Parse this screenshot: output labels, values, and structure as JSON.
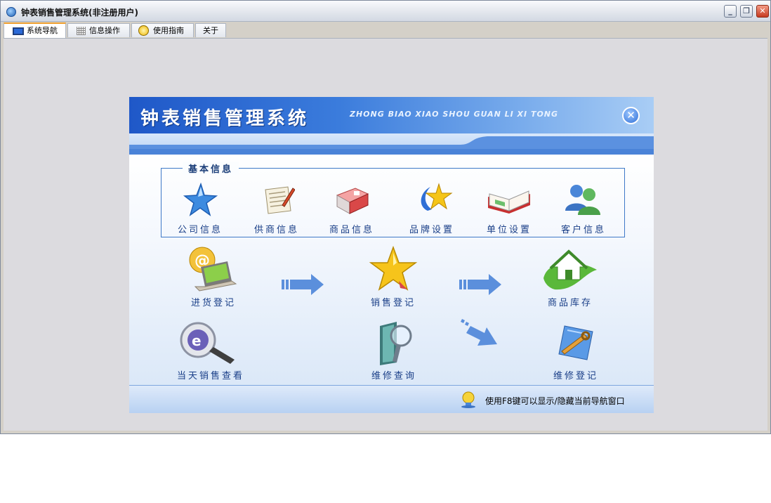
{
  "window": {
    "title": "钟表销售管理系统(非注册用户)",
    "buttons": {
      "minimize": "_",
      "restore": "❐",
      "close": "✕"
    }
  },
  "tabs": [
    {
      "label": "系统导航",
      "icon": "monitor-icon",
      "active": true
    },
    {
      "label": "信息操作",
      "icon": "grid-icon",
      "active": false
    },
    {
      "label": "使用指南",
      "icon": "help-icon",
      "active": false
    },
    {
      "label": "关于",
      "icon": "",
      "active": false
    }
  ],
  "panel": {
    "title": "钟表销售管理系统",
    "pinyin": "ZHONG BIAO XIAO SHOU  GUAN LI XI TONG",
    "close_symbol": "✕",
    "basic_info_legend": "基本信息",
    "basic_items": [
      {
        "label": "公司信息",
        "icon": "star-icon"
      },
      {
        "label": "供商信息",
        "icon": "notepad-pen-icon"
      },
      {
        "label": "商品信息",
        "icon": "book-icon"
      },
      {
        "label": "品牌设置",
        "icon": "gold-star-swoosh-icon"
      },
      {
        "label": "单位设置",
        "icon": "open-book-icon"
      },
      {
        "label": "客户信息",
        "icon": "users-icon"
      }
    ],
    "flow_items": [
      {
        "label": "进货登记",
        "icon": "laptop-email-icon"
      },
      {
        "label": "销售登记",
        "icon": "gold-star-icon"
      },
      {
        "label": "商品库存",
        "icon": "house-leaf-icon"
      },
      {
        "label": "当天销售查看",
        "icon": "magnifier-icon"
      },
      {
        "label": "维修查询",
        "icon": "book-search-icon"
      },
      {
        "label": "维修登记",
        "icon": "wrench-tools-icon"
      }
    ],
    "footer_hint": "使用F8键可以显示/隐藏当前导航窗口"
  },
  "colors": {
    "accent_blue": "#3b7cdc",
    "label_blue": "#1a3f88",
    "tab_active_border": "#f0a030"
  }
}
